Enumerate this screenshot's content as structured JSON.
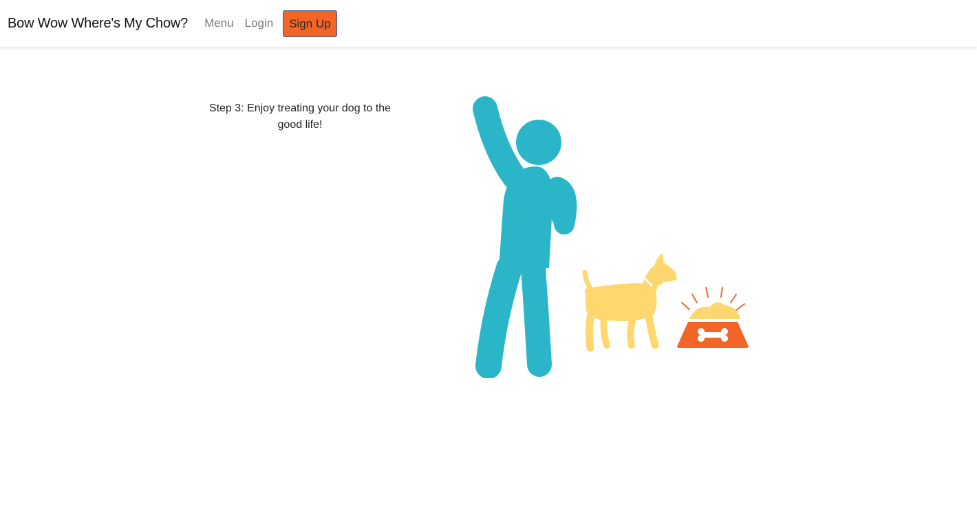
{
  "nav": {
    "brand": "Bow Wow Where's My Chow?",
    "menu_label": "Menu",
    "login_label": "Login",
    "signup_label": "Sign Up"
  },
  "main": {
    "step_text": "Step 3: Enjoy treating your dog to the good life!",
    "illustration": {
      "icons": [
        "person-cheering-icon",
        "dog-icon",
        "food-bowl-icon",
        "bone-icon"
      ],
      "colors": {
        "person": "#2bb5c9",
        "dog": "#fed76f",
        "bowl": "#f26527",
        "food": "#fed76f",
        "rays": "#f26527"
      }
    }
  },
  "colors": {
    "signup_bg": "#f26527",
    "signup_border": "#3d5a8a",
    "nav_link": "#7a7a7a"
  }
}
